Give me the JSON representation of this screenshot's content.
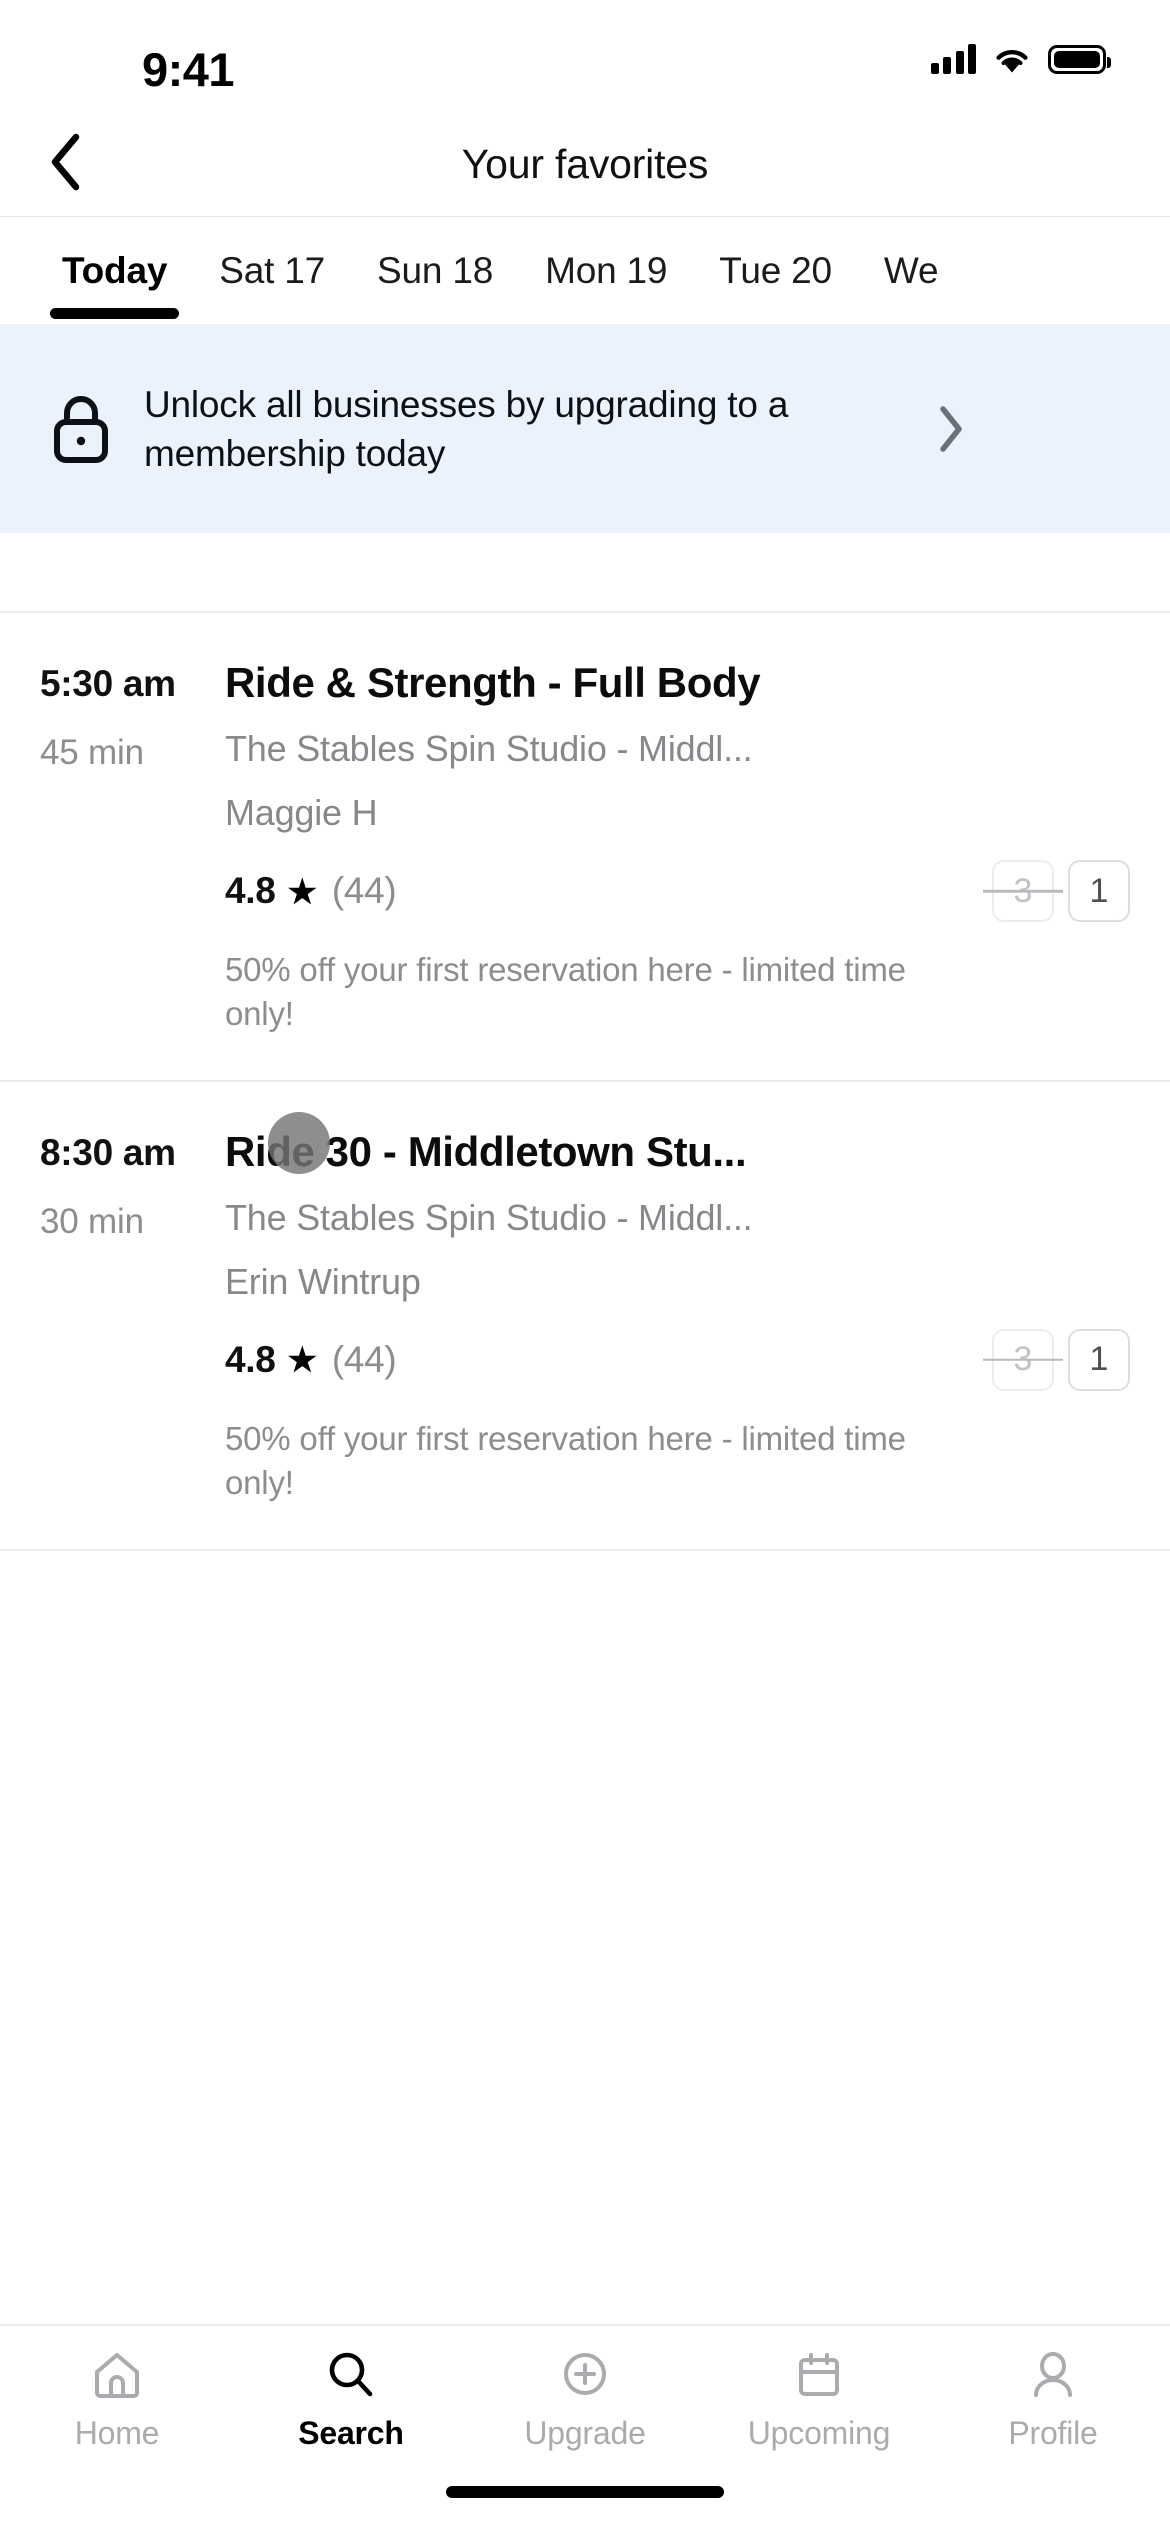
{
  "status_bar": {
    "time": "9:41",
    "signal_icon": "cellular-signal-icon",
    "wifi_icon": "wifi-icon",
    "battery_icon": "battery-full-icon"
  },
  "header": {
    "back_icon": "back-chevron-icon",
    "title": "Your favorites"
  },
  "date_tabs": {
    "selected_index": 0,
    "items": [
      {
        "label": "Today"
      },
      {
        "label": "Sat 17"
      },
      {
        "label": "Sun 18"
      },
      {
        "label": "Mon 19"
      },
      {
        "label": "Tue 20"
      },
      {
        "label": "We"
      }
    ]
  },
  "banner": {
    "lock_icon": "lock-icon",
    "text": "Unlock all businesses by upgrading to a membership today",
    "chevron_icon": "chevron-right-icon",
    "background_color": "#eaf2fb",
    "text_color": "#0d1117"
  },
  "classes": [
    {
      "time": "5:30 am",
      "duration": "45 min",
      "title": "Ride & Strength - Full Body",
      "venue": "The Stables Spin Studio - Middl...",
      "instructor": "Maggie H",
      "rating": "4.8",
      "star_icon": "star-filled-icon",
      "review_count": "(44)",
      "credits_original": "3",
      "credits_discounted": "1",
      "promo": "50% off your first reservation here - limited time only!"
    },
    {
      "time": "8:30 am",
      "duration": "30 min",
      "title": "Ride 30 - Middletown Stu...",
      "venue": "The Stables Spin Studio - Middl...",
      "instructor": "Erin Wintrup",
      "rating": "4.8",
      "star_icon": "star-filled-icon",
      "review_count": "(44)",
      "credits_original": "3",
      "credits_discounted": "1",
      "promo": "50% off your first reservation here - limited time only!"
    }
  ],
  "tap_indicator": {
    "label": "touch-point",
    "color": "#757575"
  },
  "tab_bar": {
    "active_index": 1,
    "items": [
      {
        "label": "Home",
        "icon": "home-icon"
      },
      {
        "label": "Search",
        "icon": "search-icon"
      },
      {
        "label": "Upgrade",
        "icon": "plus-circle-icon"
      },
      {
        "label": "Upcoming",
        "icon": "calendar-icon"
      },
      {
        "label": "Profile",
        "icon": "person-icon"
      }
    ]
  }
}
